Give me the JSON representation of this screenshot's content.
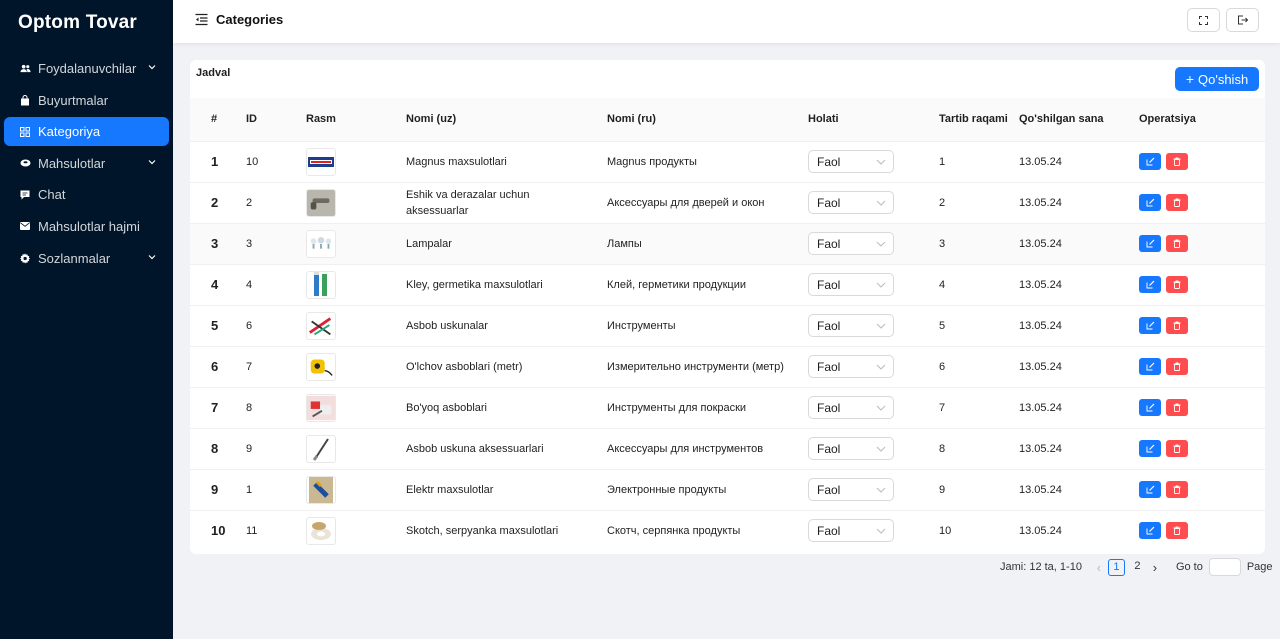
{
  "app": {
    "title": "Optom Tovar"
  },
  "sidebar": {
    "items": [
      {
        "label": "Foydalanuvchilar",
        "icon": "users-icon",
        "has_submenu": true
      },
      {
        "label": "Buyurtmalar",
        "icon": "shopping-bag-icon",
        "has_submenu": false
      },
      {
        "label": "Kategoriya",
        "icon": "grid-icon",
        "has_submenu": false,
        "active": true
      },
      {
        "label": "Mahsulotlar",
        "icon": "product-icon",
        "has_submenu": true
      },
      {
        "label": "Chat",
        "icon": "chat-icon",
        "has_submenu": false
      },
      {
        "label": "Mahsulotlar hajmi",
        "icon": "mail-icon",
        "has_submenu": false
      },
      {
        "label": "Sozlanmalar",
        "icon": "gear-icon",
        "has_submenu": true
      }
    ]
  },
  "header": {
    "title": "Categories"
  },
  "card": {
    "title": "Jadval",
    "add_label": "Qo'shish"
  },
  "table": {
    "headers": [
      "#",
      "ID",
      "Rasm",
      "Nomi (uz)",
      "Nomi (ru)",
      "Holati",
      "Tartib raqami",
      "Qo'shilgan sana",
      "Operatsiya"
    ],
    "rows": [
      {
        "num": "1",
        "id": "10",
        "image": "magnus-logo",
        "name_uz": "Magnus maxsulotlari",
        "name_ru": "Magnus продукты",
        "status": "Faol",
        "order": "1",
        "date": "13.05.24"
      },
      {
        "num": "2",
        "id": "2",
        "image": "door-handle",
        "name_uz": "Eshik va derazalar uchun aksessuarlar",
        "name_ru": "Аксессуары для дверей и окон",
        "status": "Faol",
        "order": "2",
        "date": "13.05.24"
      },
      {
        "num": "3",
        "id": "3",
        "image": "lamps",
        "name_uz": "Lampalar",
        "name_ru": "Лампы",
        "status": "Faol",
        "order": "3",
        "date": "13.05.24"
      },
      {
        "num": "4",
        "id": "4",
        "image": "sealant",
        "name_uz": "Kley, germetika maxsulotlari",
        "name_ru": "Клей, герметики продукции",
        "status": "Faol",
        "order": "4",
        "date": "13.05.24"
      },
      {
        "num": "5",
        "id": "6",
        "image": "tools",
        "name_uz": "Asbob uskunalar",
        "name_ru": "Инструменты",
        "status": "Faol",
        "order": "5",
        "date": "13.05.24"
      },
      {
        "num": "6",
        "id": "7",
        "image": "tape-measure",
        "name_uz": "O'lchov asboblari (metr)",
        "name_ru": "Измерительно инструменти (метр)",
        "status": "Faol",
        "order": "6",
        "date": "13.05.24"
      },
      {
        "num": "7",
        "id": "8",
        "image": "paint-tools",
        "name_uz": "Bo'yoq asboblari",
        "name_ru": "Инструменты для покраски",
        "status": "Faol",
        "order": "7",
        "date": "13.05.24"
      },
      {
        "num": "8",
        "id": "9",
        "image": "tool-accessory",
        "name_uz": "Asbob uskuna aksessuarlari",
        "name_ru": "Аксессуары для инструментов",
        "status": "Faol",
        "order": "8",
        "date": "13.05.24"
      },
      {
        "num": "9",
        "id": "1",
        "image": "electric",
        "name_uz": "Elektr maxsulotlar",
        "name_ru": "Электронные продукты",
        "status": "Faol",
        "order": "9",
        "date": "13.05.24"
      },
      {
        "num": "10",
        "id": "11",
        "image": "tape-roll",
        "name_uz": "Skotch, serpyanka maxsulotlari",
        "name_ru": "Скотч, серпянка продукты",
        "status": "Faol",
        "order": "10",
        "date": "13.05.24"
      }
    ]
  },
  "pagination": {
    "total": "Jami: 12 ta, 1-10",
    "pages": [
      "1",
      "2"
    ],
    "current": "1",
    "goto_label": "Go to",
    "page_label": "Page"
  },
  "colors": {
    "sidebar_bg": "#001529",
    "primary": "#1677ff",
    "danger": "#ff4d4f"
  }
}
